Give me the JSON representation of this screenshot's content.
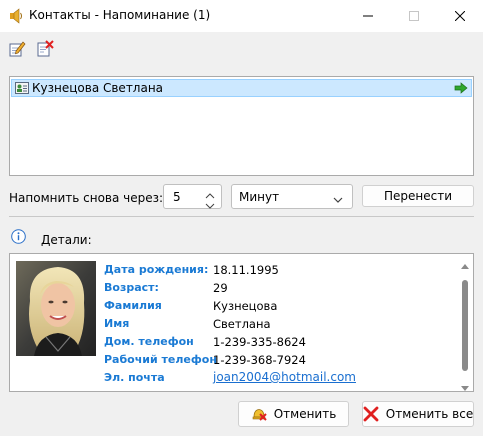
{
  "window": {
    "title": "Контакты - Напоминание (1)",
    "app_icon": "speaker-icon",
    "controls": [
      "minimize-icon",
      "maximize-icon",
      "close-icon"
    ]
  },
  "toolbar": {
    "buttons": [
      {
        "icon": "edit-icon"
      },
      {
        "icon": "delete-icon"
      }
    ]
  },
  "reminders": {
    "items": [
      {
        "name": "Кузнецова Светлана",
        "icon": "contact-card-icon",
        "action_icon": "green-arrow-right-icon",
        "selected": true
      }
    ]
  },
  "snooze": {
    "label": "Напомнить снова через:",
    "value": "5",
    "unit": "Минут",
    "button": "Перенести"
  },
  "details": {
    "label": "Детали:",
    "icon": "info-icon",
    "photo": "contact-photo",
    "fields": [
      {
        "label": "Дата рождения:",
        "value": "18.11.1995"
      },
      {
        "label": "Возраст:",
        "value": "29"
      },
      {
        "label": "Фамилия",
        "value": "Кузнецова"
      },
      {
        "label": "Имя",
        "value": "Светлана"
      },
      {
        "label": "Дом. телефон",
        "value": "1-239-335-8624"
      },
      {
        "label": "Рабочий телефон",
        "value": "1-239-368-7924"
      },
      {
        "label": "Эл. почта",
        "value": "joan2004@hotmail.com"
      }
    ]
  },
  "footer": {
    "cancel": "Отменить",
    "cancel_all": "Отменить все"
  },
  "colors": {
    "accent_label": "#1a7ad4",
    "selection": "#cce8ff",
    "link": "#1a6fd0"
  }
}
